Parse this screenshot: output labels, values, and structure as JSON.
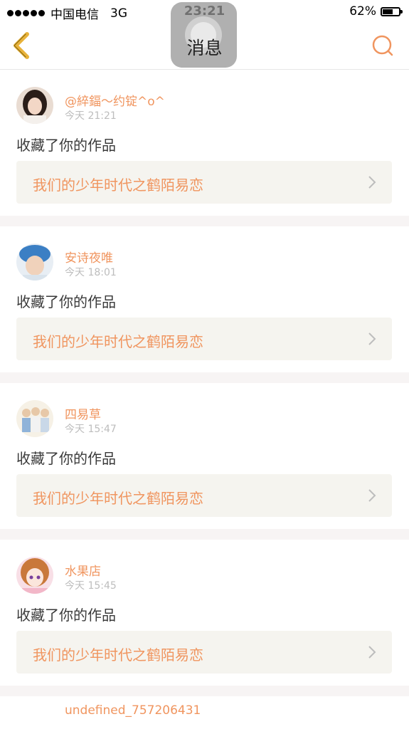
{
  "status_bar": {
    "carrier": "中国电信",
    "network": "3G",
    "time": "23:21",
    "battery": "62%",
    "battery_level": 0.62
  },
  "nav": {
    "title": "消息",
    "back_icon": "chevron-left-icon",
    "search_icon": "search-icon"
  },
  "colors": {
    "accent": "#f0955f",
    "back_icon": "#e8b23a",
    "card_bg": "#f5f4ef",
    "divider": "#f7f4f4"
  },
  "messages": [
    {
      "user": "@綷鍢～约锭^o^",
      "time": "今天 21:21",
      "action": "收藏了你的作品",
      "work": "我们的少年时代之鹤陌易恋"
    },
    {
      "user": "安诗夜唯",
      "time": "今天 18:01",
      "action": "收藏了你的作品",
      "work": "我们的少年时代之鹤陌易恋"
    },
    {
      "user": "四易草",
      "time": "今天 15:47",
      "action": "收藏了你的作品",
      "work": "我们的少年时代之鹤陌易恋"
    },
    {
      "user": "水果店",
      "time": "今天 15:45",
      "action": "收藏了你的作品",
      "work": "我们的少年时代之鹤陌易恋"
    },
    {
      "user": "undefined_757206431"
    }
  ]
}
